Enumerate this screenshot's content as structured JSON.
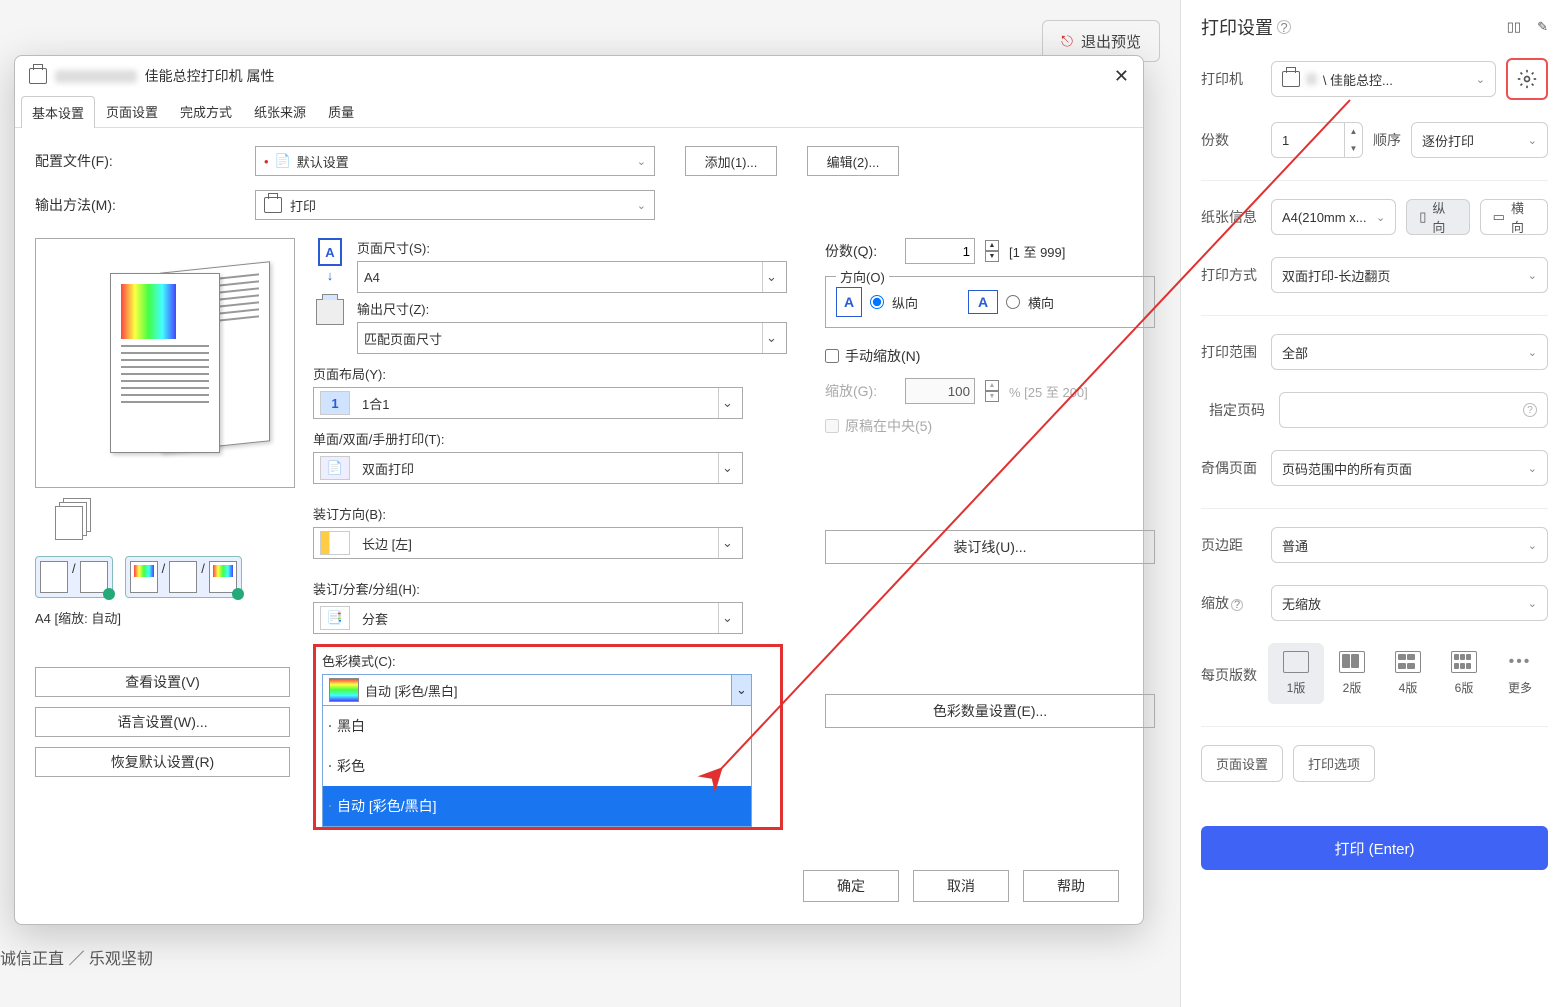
{
  "exit_preview": "退出预览",
  "sidebar": {
    "title": "打印设置",
    "printer_label": "打印机",
    "printer_value": "\\          佳能总控...",
    "copies_label": "份数",
    "copies_value": "1",
    "seq_label": "顺序",
    "seq_value": "逐份打印",
    "paper_label": "纸张信息",
    "paper_value": "A4(210mm x...",
    "orient_portrait": "纵向",
    "orient_landscape": "横向",
    "method_label": "打印方式",
    "method_value": "双面打印-长边翻页",
    "range_label": "打印范围",
    "range_value": "全部",
    "page_spec_label": "指定页码",
    "odd_even_label": "奇偶页面",
    "odd_even_value": "页码范围中的所有页面",
    "margin_label": "页边距",
    "margin_value": "普通",
    "scale_label": "缩放",
    "scale_value": "无缩放",
    "nup_label": "每页版数",
    "nup": [
      "1版",
      "2版",
      "4版",
      "6版",
      "更多"
    ],
    "page_setup": "页面设置",
    "print_options": "打印选项",
    "print_btn": "打印 (Enter)"
  },
  "dialog": {
    "title_suffix": "佳能总控打印机 属性",
    "tabs": [
      "基本设置",
      "页面设置",
      "完成方式",
      "纸张来源",
      "质量"
    ],
    "profile_label": "配置文件(F):",
    "profile_value": "默认设置",
    "add_btn": "添加(1)...",
    "edit_btn": "编辑(2)...",
    "output_label": "输出方法(M):",
    "output_value": "打印",
    "page_size_label": "页面尺寸(S):",
    "page_size_value": "A4",
    "output_size_label": "输出尺寸(Z):",
    "output_size_value": "匹配页面尺寸",
    "layout_label": "页面布局(Y):",
    "layout_value": "1合1",
    "duplex_label": "单面/双面/手册打印(T):",
    "duplex_value": "双面打印",
    "bind_dir_label": "装订方向(B):",
    "bind_dir_value": "长边 [左]",
    "bind_group_label": "装订/分套/分组(H):",
    "bind_group_value": "分套",
    "color_mode_label": "色彩模式(C):",
    "color_mode_value": "自动 [彩色/黑白]",
    "color_options": [
      "黑白",
      "彩色",
      "自动 [彩色/黑白]"
    ],
    "copies_label": "份数(Q):",
    "copies_value": "1",
    "copies_hint": "[1 至 999]",
    "orient_label": "方向(O)",
    "orient_p": "纵向",
    "orient_l": "横向",
    "manual_scale": "手动缩放(N)",
    "scale_label": "缩放(G):",
    "scale_value": "100",
    "scale_hint": "% [25 至 200]",
    "center_orig": "原稿在中央(5)",
    "gutter_btn": "装订线(U)...",
    "color_count_btn": "色彩数量设置(E)...",
    "preview_caption": "A4 [缩放: 自动]",
    "view_settings": "查看设置(V)",
    "lang_settings": "语言设置(W)...",
    "restore_default": "恢复默认设置(R)",
    "ok": "确定",
    "cancel": "取消",
    "help": "帮助"
  },
  "footer": "诚信正直 ／ 乐观坚韧"
}
